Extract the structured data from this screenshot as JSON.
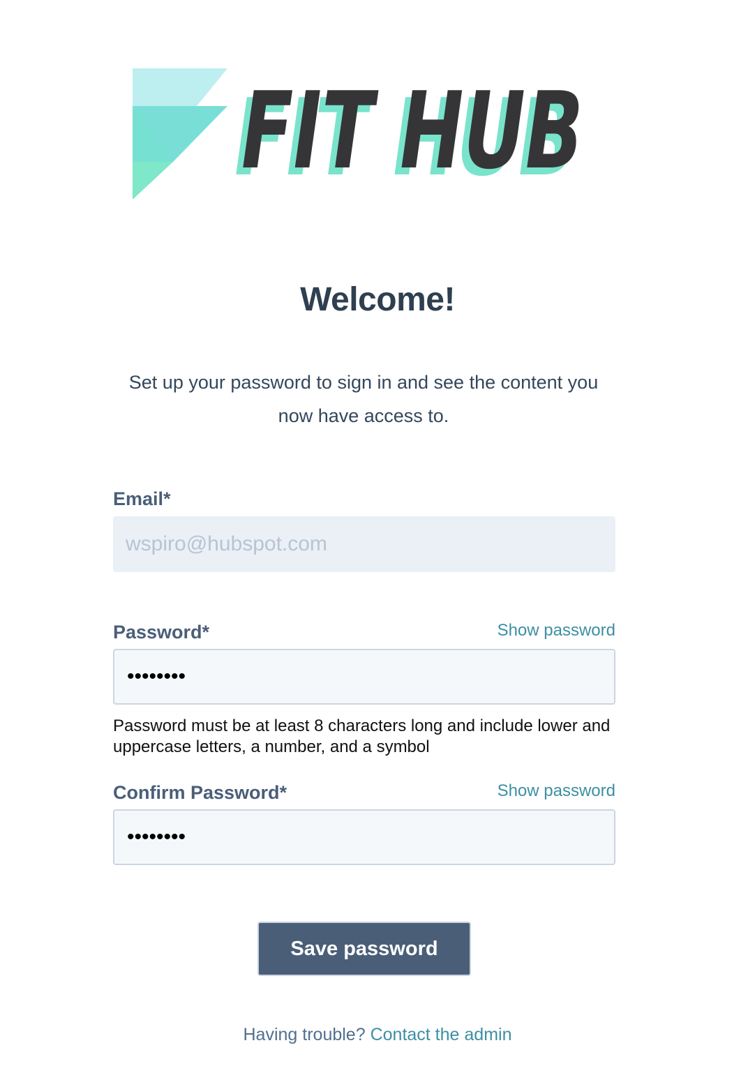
{
  "logo": {
    "text": "FIT HUB",
    "colors": {
      "text": "#353537",
      "shadow": "#79e3cb",
      "flag_top": "#bdeef0",
      "flag_mid": "#79dfd6",
      "flag_bottom": "#7ee8c9"
    }
  },
  "heading": "Welcome!",
  "subtitle": "Set up your password to sign in and see the content you now have access to.",
  "form": {
    "email": {
      "label": "Email*",
      "value": "wspiro@hubspot.com"
    },
    "password": {
      "label": "Password*",
      "show_label": "Show password",
      "value": "••••••••"
    },
    "hint": "Password must be at least 8 characters long and include lower and uppercase letters, a number, and a symbol",
    "confirm": {
      "label": "Confirm Password*",
      "show_label": "Show password",
      "value": "••••••••"
    },
    "submit_label": "Save password"
  },
  "footer": {
    "prompt": "Having trouble?",
    "link": "Contact the admin"
  },
  "colors": {
    "accent": "#3d8fa4",
    "button": "#4a5e78",
    "heading": "#2e3f50"
  }
}
